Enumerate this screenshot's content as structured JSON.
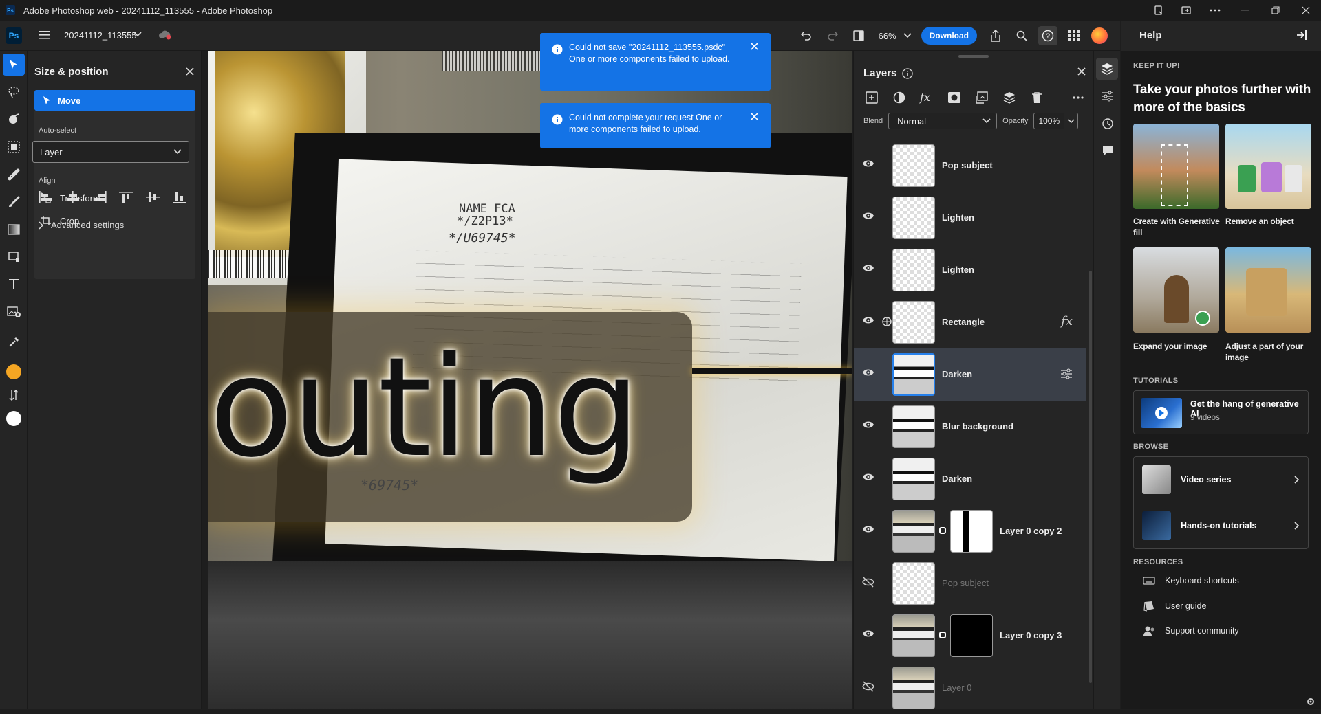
{
  "window": {
    "title": "Adobe Photoshop web - 20241112_113555 - Adobe Photoshop",
    "ps_badge": "Ps"
  },
  "appbar": {
    "doc_name": "20241112_113555",
    "zoom": "66%",
    "download_label": "Download"
  },
  "toolbar": {
    "tools": [
      "move-icon",
      "lasso-icon",
      "quick-select-icon",
      "object-select-icon",
      "healing-brush-icon",
      "brush-icon",
      "gradient-icon",
      "crop-transform-icon",
      "type-icon",
      "add-image-icon",
      "eyedropper-icon"
    ],
    "foreground_color": "#f5a623",
    "background_color": "#ffffff"
  },
  "properties": {
    "title": "Size & position",
    "move_label": "Move",
    "auto_select_label": "Auto-select",
    "auto_select_value": "Layer",
    "align_label": "Align",
    "advanced_label": "Advanced settings",
    "transform_label": "Transform",
    "crop_label": "Crop"
  },
  "canvas": {
    "text": "outing",
    "paper_lines": [
      "NAME FCA",
      "*/Z2P13*",
      "*/U69745*",
      "*69745*"
    ]
  },
  "toasts": [
    {
      "message": "Could not save \"20241112_113555.psdc\" One or more components failed to upload."
    },
    {
      "message": "Could not complete your request One or more components failed to upload."
    }
  ],
  "layers_panel": {
    "title": "Layers",
    "blend_label": "Blend",
    "blend_value": "Normal",
    "opacity_label": "Opacity",
    "opacity_value": "100%",
    "layers": [
      {
        "name": "Pop subject"
      },
      {
        "name": "Lighten"
      },
      {
        "name": "Lighten"
      },
      {
        "name": "Rectangle"
      },
      {
        "name": "Darken"
      },
      {
        "name": "Blur background"
      },
      {
        "name": "Darken"
      },
      {
        "name": "Layer 0 copy 2"
      },
      {
        "name": "Pop subject"
      },
      {
        "name": "Layer 0 copy 3"
      },
      {
        "name": "Layer 0"
      }
    ]
  },
  "help": {
    "title": "Help",
    "keep_it_up": "KEEP IT UP!",
    "headline": "Take your photos further with more of the basics",
    "cards": [
      {
        "caption": "Create with Generative fill"
      },
      {
        "caption": "Remove an object"
      },
      {
        "caption": "Expand your image"
      },
      {
        "caption": "Adjust a part of your image"
      }
    ],
    "tutorials_label": "TUTORIALS",
    "tutorial_title": "Get the hang of generative AI",
    "tutorial_sub": "9 videos",
    "browse_label": "BROWSE",
    "browse_items": [
      "Video series",
      "Hands-on tutorials"
    ],
    "resources_label": "RESOURCES",
    "resources": [
      "Keyboard shortcuts",
      "User guide",
      "Support community"
    ]
  },
  "colors": {
    "accent": "#1473e6",
    "panel": "#252525",
    "selected_layer": "#3a3f48"
  }
}
